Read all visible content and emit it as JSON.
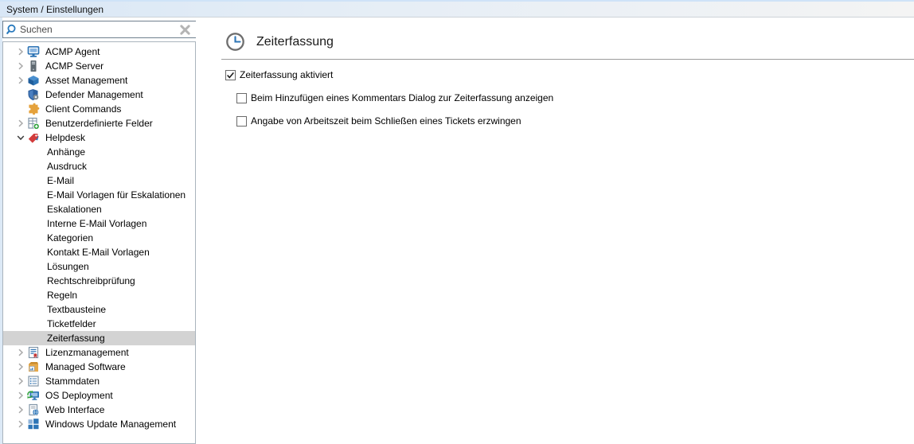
{
  "title_bar": {
    "label": "System / Einstellungen"
  },
  "search": {
    "placeholder": "Suchen",
    "value": "",
    "search_icon": "search-icon",
    "clear_icon": "clear-search-icon"
  },
  "tree": {
    "items": [
      {
        "label": "ACMP Agent",
        "icon": "acmp-agent-icon",
        "state": "collapsed",
        "indent": 0,
        "selected": false
      },
      {
        "label": "ACMP Server",
        "icon": "acmp-server-icon",
        "state": "collapsed",
        "indent": 0,
        "selected": false
      },
      {
        "label": "Asset Management",
        "icon": "asset-management-icon",
        "state": "collapsed",
        "indent": 0,
        "selected": false
      },
      {
        "label": "Defender Management",
        "icon": "defender-management-icon",
        "state": "none",
        "indent": 0,
        "selected": false
      },
      {
        "label": "Client Commands",
        "icon": "client-commands-icon",
        "state": "none",
        "indent": 0,
        "selected": false
      },
      {
        "label": "Benutzerdefinierte Felder",
        "icon": "custom-fields-icon",
        "state": "collapsed",
        "indent": 0,
        "selected": false
      },
      {
        "label": "Helpdesk",
        "icon": "helpdesk-icon",
        "state": "expanded",
        "indent": 0,
        "selected": false
      },
      {
        "label": "Anhänge",
        "icon": null,
        "state": "none",
        "indent": 1,
        "selected": false
      },
      {
        "label": "Ausdruck",
        "icon": null,
        "state": "none",
        "indent": 1,
        "selected": false
      },
      {
        "label": "E-Mail",
        "icon": null,
        "state": "none",
        "indent": 1,
        "selected": false
      },
      {
        "label": "E-Mail Vorlagen für Eskalationen",
        "icon": null,
        "state": "none",
        "indent": 1,
        "selected": false
      },
      {
        "label": "Eskalationen",
        "icon": null,
        "state": "none",
        "indent": 1,
        "selected": false
      },
      {
        "label": "Interne E-Mail Vorlagen",
        "icon": null,
        "state": "none",
        "indent": 1,
        "selected": false
      },
      {
        "label": "Kategorien",
        "icon": null,
        "state": "none",
        "indent": 1,
        "selected": false
      },
      {
        "label": "Kontakt E-Mail Vorlagen",
        "icon": null,
        "state": "none",
        "indent": 1,
        "selected": false
      },
      {
        "label": "Lösungen",
        "icon": null,
        "state": "none",
        "indent": 1,
        "selected": false
      },
      {
        "label": "Rechtschreibprüfung",
        "icon": null,
        "state": "none",
        "indent": 1,
        "selected": false
      },
      {
        "label": "Regeln",
        "icon": null,
        "state": "none",
        "indent": 1,
        "selected": false
      },
      {
        "label": "Textbausteine",
        "icon": null,
        "state": "none",
        "indent": 1,
        "selected": false
      },
      {
        "label": "Ticketfelder",
        "icon": null,
        "state": "none",
        "indent": 1,
        "selected": false
      },
      {
        "label": "Zeiterfassung",
        "icon": null,
        "state": "none",
        "indent": 1,
        "selected": true
      },
      {
        "label": "Lizenzmanagement",
        "icon": "license-management-icon",
        "state": "collapsed",
        "indent": 0,
        "selected": false
      },
      {
        "label": "Managed Software",
        "icon": "managed-software-icon",
        "state": "collapsed",
        "indent": 0,
        "selected": false
      },
      {
        "label": "Stammdaten",
        "icon": "stammdaten-icon",
        "state": "collapsed",
        "indent": 0,
        "selected": false
      },
      {
        "label": "OS Deployment",
        "icon": "os-deployment-icon",
        "state": "collapsed",
        "indent": 0,
        "selected": false
      },
      {
        "label": "Web Interface",
        "icon": "web-interface-icon",
        "state": "collapsed",
        "indent": 0,
        "selected": false
      },
      {
        "label": "Windows Update Management",
        "icon": "windows-update-management-icon",
        "state": "collapsed",
        "indent": 0,
        "selected": false
      }
    ]
  },
  "panel": {
    "icon": "clock-icon",
    "title": "Zeiterfassung",
    "checkboxes": [
      {
        "label": "Zeiterfassung aktiviert",
        "checked": true,
        "indent": 0
      },
      {
        "label": "Beim Hinzufügen eines Kommentars Dialog zur Zeiterfassung anzeigen",
        "checked": false,
        "indent": 1
      },
      {
        "label": "Angabe von Arbeitszeit beim Schließen eines Tickets erzwingen",
        "checked": false,
        "indent": 1
      }
    ]
  },
  "colors": {
    "titlebar_left": "#d9e7f6",
    "titlebar_right": "#f4f4f4",
    "selection_bg": "#d3d3d3",
    "accent_blue": "#2e75b6",
    "divider_gray": "#9b9b9b"
  }
}
